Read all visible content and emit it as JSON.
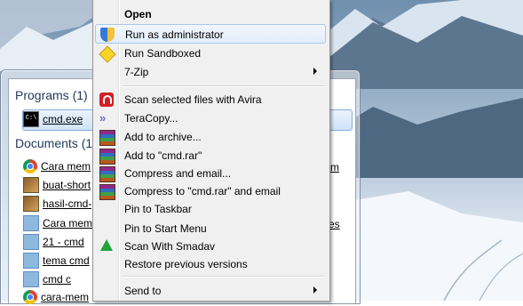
{
  "start_menu": {
    "programs_heading": "Programs (1)",
    "documents_heading": "Documents (1",
    "programs": [
      {
        "label": "cmd.exe",
        "icon": "cmd-icon"
      }
    ],
    "documents": [
      {
        "label": "Cara mem",
        "icon": "chrome-icon",
        "tail": "m"
      },
      {
        "label": "buat-short",
        "icon": "image-thumb-icon",
        "tail": ""
      },
      {
        "label": "hasil-cmd-",
        "icon": "image-thumb-icon",
        "tail": ""
      },
      {
        "label": "Cara mem",
        "icon": "folder-icon",
        "tail": "es"
      },
      {
        "label": "21 - cmd",
        "icon": "folder-icon",
        "tail": ""
      },
      {
        "label": "tema cmd",
        "icon": "folder-icon",
        "tail": ""
      },
      {
        "label": "cmd c",
        "icon": "folder-icon",
        "tail": ""
      },
      {
        "label": "cara-mem",
        "icon": "chrome-icon",
        "tail": ""
      }
    ]
  },
  "context_menu": {
    "items": [
      {
        "label": "Open",
        "icon": "",
        "bold": true,
        "submenu": false
      },
      {
        "label": "Run as administrator",
        "icon": "uac-shield-icon",
        "bold": false,
        "submenu": false,
        "highlighted": true
      },
      {
        "label": "Run Sandboxed",
        "icon": "sandboxie-icon",
        "bold": false,
        "submenu": false
      },
      {
        "label": "7-Zip",
        "icon": "",
        "bold": false,
        "submenu": true
      },
      {
        "label": "Scan selected files with Avira",
        "icon": "avira-icon",
        "bold": false,
        "submenu": false
      },
      {
        "label": "TeraCopy...",
        "icon": "teracopy-icon",
        "bold": false,
        "submenu": false
      },
      {
        "label": "Add to archive...",
        "icon": "winrar-icon",
        "bold": false,
        "submenu": false
      },
      {
        "label": "Add to \"cmd.rar\"",
        "icon": "winrar-icon",
        "bold": false,
        "submenu": false
      },
      {
        "label": "Compress and email...",
        "icon": "winrar-icon",
        "bold": false,
        "submenu": false
      },
      {
        "label": "Compress to \"cmd.rar\" and email",
        "icon": "winrar-icon",
        "bold": false,
        "submenu": false
      },
      {
        "label": "Pin to Taskbar",
        "icon": "",
        "bold": false,
        "submenu": false
      },
      {
        "label": "Pin to Start Menu",
        "icon": "",
        "bold": false,
        "submenu": false
      },
      {
        "label": "Scan With Smadav",
        "icon": "smadav-icon",
        "bold": false,
        "submenu": false
      },
      {
        "label": "Restore previous versions",
        "icon": "",
        "bold": false,
        "submenu": false
      },
      {
        "label": "Send to",
        "icon": "",
        "bold": false,
        "submenu": true
      }
    ]
  },
  "colors": {
    "section_heading": "#1e395b",
    "menu_background": "#f0f0f0",
    "highlight_border": "#a8c8ee"
  }
}
